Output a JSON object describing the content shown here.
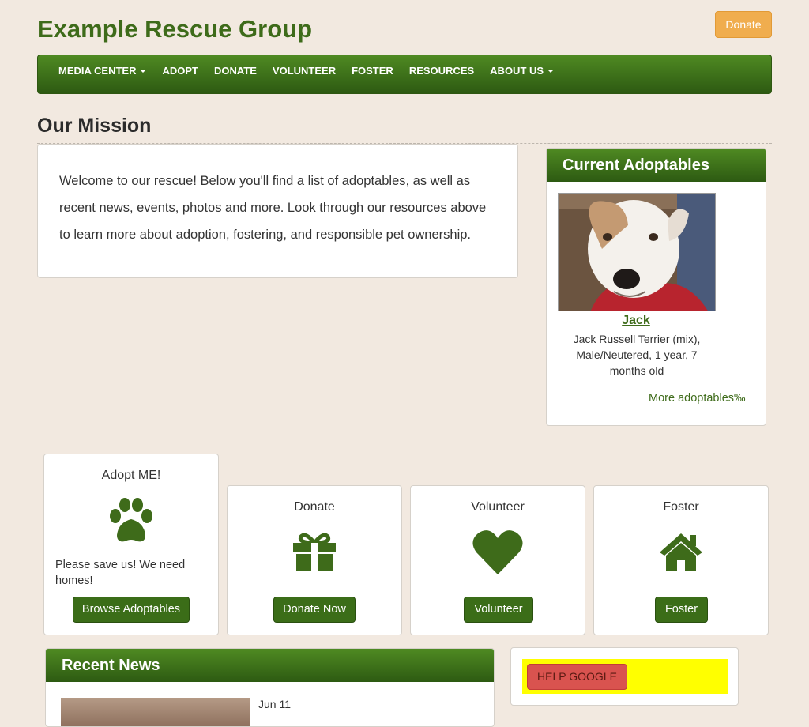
{
  "site": {
    "title": "Example Rescue Group",
    "donate_label": "Donate"
  },
  "nav": {
    "items": [
      {
        "label": "MEDIA CENTER",
        "dropdown": true
      },
      {
        "label": "ADOPT",
        "dropdown": false
      },
      {
        "label": "DONATE",
        "dropdown": false
      },
      {
        "label": "VOLUNTEER",
        "dropdown": false
      },
      {
        "label": "FOSTER",
        "dropdown": false
      },
      {
        "label": "RESOURCES",
        "dropdown": false
      },
      {
        "label": "ABOUT US",
        "dropdown": true
      }
    ]
  },
  "mission": {
    "title": "Our Mission",
    "text": "Welcome to our rescue! Below you'll find a list of adoptables, as well as recent news, events, photos and more. Look through our resources above to learn more about adoption, fostering, and responsible pet ownership."
  },
  "adoptables": {
    "heading": "Current Adoptables",
    "pet_name": "Jack",
    "pet_desc": "Jack Russell Terrier (mix), Male/Neutered, 1 year, 7 months old",
    "more_link": "More adoptables‰"
  },
  "cards": {
    "adopt": {
      "title": "Adopt ME!",
      "text": "Please save us! We need homes!",
      "button": "Browse Adoptables",
      "icon": "paw-icon"
    },
    "donate": {
      "title": "Donate",
      "button": "Donate Now",
      "icon": "gift-icon"
    },
    "volunteer": {
      "title": "Volunteer",
      "button": "Volunteer",
      "icon": "heart-icon"
    },
    "foster": {
      "title": "Foster",
      "button": "Foster",
      "icon": "home-icon"
    }
  },
  "news": {
    "heading": "Recent News",
    "date": "Jun 11"
  },
  "help": {
    "button": "HELP GOOGLE"
  },
  "colors": {
    "brand_green": "#3e6b1a",
    "donate_orange": "#f0ad4e",
    "help_red": "#d9534f",
    "highlight_yellow": "#ffff00",
    "background": "#f2e9e0"
  }
}
